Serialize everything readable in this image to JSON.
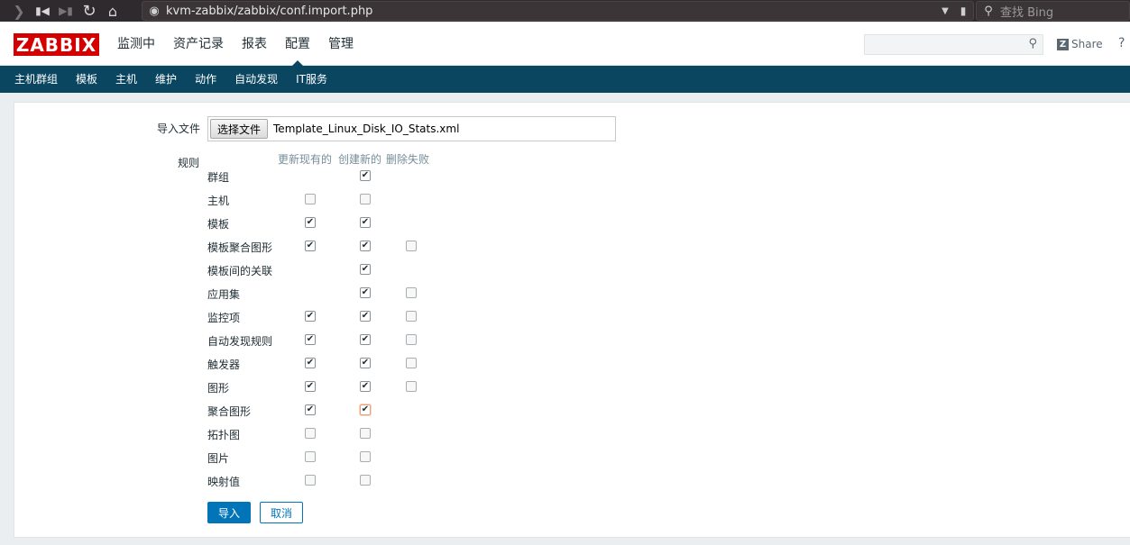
{
  "browser": {
    "url": "kvm-zabbix/zabbix/conf.import.php",
    "search_placeholder": "查找 Bing"
  },
  "header": {
    "logo": "ZABBIX",
    "menu": [
      "监测中",
      "资产记录",
      "报表",
      "配置",
      "管理"
    ],
    "active_menu": "配置",
    "share_label": "Share",
    "help_label": "?"
  },
  "submenu": [
    "主机群组",
    "模板",
    "主机",
    "维护",
    "动作",
    "自动发现",
    "IT服务"
  ],
  "form": {
    "import_file_label": "导入文件",
    "choose_file_label": "选择文件",
    "file_name": "Template_Linux_Disk_IO_Stats.xml",
    "rules_label": "规则",
    "columns": [
      "更新现有的",
      "创建新的",
      "删除失败"
    ],
    "rules": [
      {
        "label": "群组",
        "update": null,
        "create": true,
        "delete": null
      },
      {
        "label": "主机",
        "update": false,
        "create": false,
        "delete": null
      },
      {
        "label": "模板",
        "update": true,
        "create": true,
        "delete": null
      },
      {
        "label": "模板聚合图形",
        "update": true,
        "create": true,
        "delete": false
      },
      {
        "label": "模板间的关联",
        "update": null,
        "create": true,
        "delete": null
      },
      {
        "label": "应用集",
        "update": null,
        "create": true,
        "delete": false
      },
      {
        "label": "监控项",
        "update": true,
        "create": true,
        "delete": false
      },
      {
        "label": "自动发现规则",
        "update": true,
        "create": true,
        "delete": false
      },
      {
        "label": "触发器",
        "update": true,
        "create": true,
        "delete": false
      },
      {
        "label": "图形",
        "update": true,
        "create": true,
        "delete": false
      },
      {
        "label": "聚合图形",
        "update": true,
        "create": true,
        "delete": null
      },
      {
        "label": "拓扑图",
        "update": false,
        "create": false,
        "delete": null
      },
      {
        "label": "图片",
        "update": false,
        "create": false,
        "delete": null
      },
      {
        "label": "映射值",
        "update": false,
        "create": false,
        "delete": null
      }
    ],
    "import_button": "导入",
    "cancel_button": "取消"
  }
}
